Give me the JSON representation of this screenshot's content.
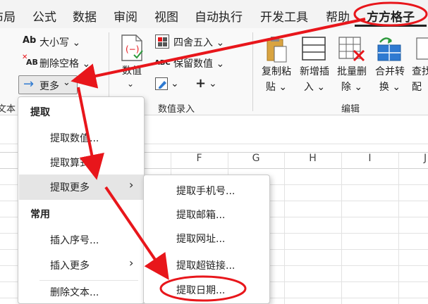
{
  "tabs": [
    {
      "label": "布局"
    },
    {
      "label": "公式"
    },
    {
      "label": "数据"
    },
    {
      "label": "审阅"
    },
    {
      "label": "视图"
    },
    {
      "label": "自动执行"
    },
    {
      "label": "开发工具"
    },
    {
      "label": "帮助"
    },
    {
      "label": "方方格子"
    }
  ],
  "ribbon": {
    "text_group": {
      "case_label": "大小写",
      "case_icon_text": "Ab",
      "remove_space_label": "删除空格",
      "remove_space_icon_text": "AB",
      "more_label": "更多",
      "group_label": "文本"
    },
    "value_group": {
      "value_label": "数值",
      "round_label": "四舍五入",
      "keep_value_label": "保留数值",
      "keep_value_icon_text": "ABC",
      "plus_label": "+",
      "group_label": "数值录入"
    },
    "edit_group": {
      "copy_paste_label_1": "复制粘",
      "copy_paste_label_2": "贴",
      "new_insert_label_1": "新增插",
      "new_insert_label_2": "入",
      "batch_delete_label_1": "批量删",
      "batch_delete_label_2": "除",
      "merge_convert_label_1": "合并转",
      "merge_convert_label_2": "换",
      "lookup_label_1": "查找",
      "lookup_label_2": "配",
      "group_label": "编辑"
    }
  },
  "sheet": {
    "columns": [
      "F",
      "G",
      "H",
      "I",
      "J"
    ]
  },
  "menu": {
    "section_extract": "提取",
    "extract_value": "提取数值...",
    "extract_formula": "提取算式...",
    "extract_more": "提取更多",
    "section_common": "常用",
    "insert_serial": "插入序号...",
    "insert_more": "插入更多",
    "delete_text": "删除文本..."
  },
  "submenu": {
    "phone": "提取手机号...",
    "email": "提取邮箱...",
    "url": "提取网址...",
    "hyperlink": "提取超链接...",
    "date": "提取日期..."
  },
  "colors": {
    "annotation_red": "#e8161b",
    "accent_blue": "#2f7ad1",
    "tab_bar": "#f3f3f3",
    "ribbon": "#f9f9f9"
  }
}
